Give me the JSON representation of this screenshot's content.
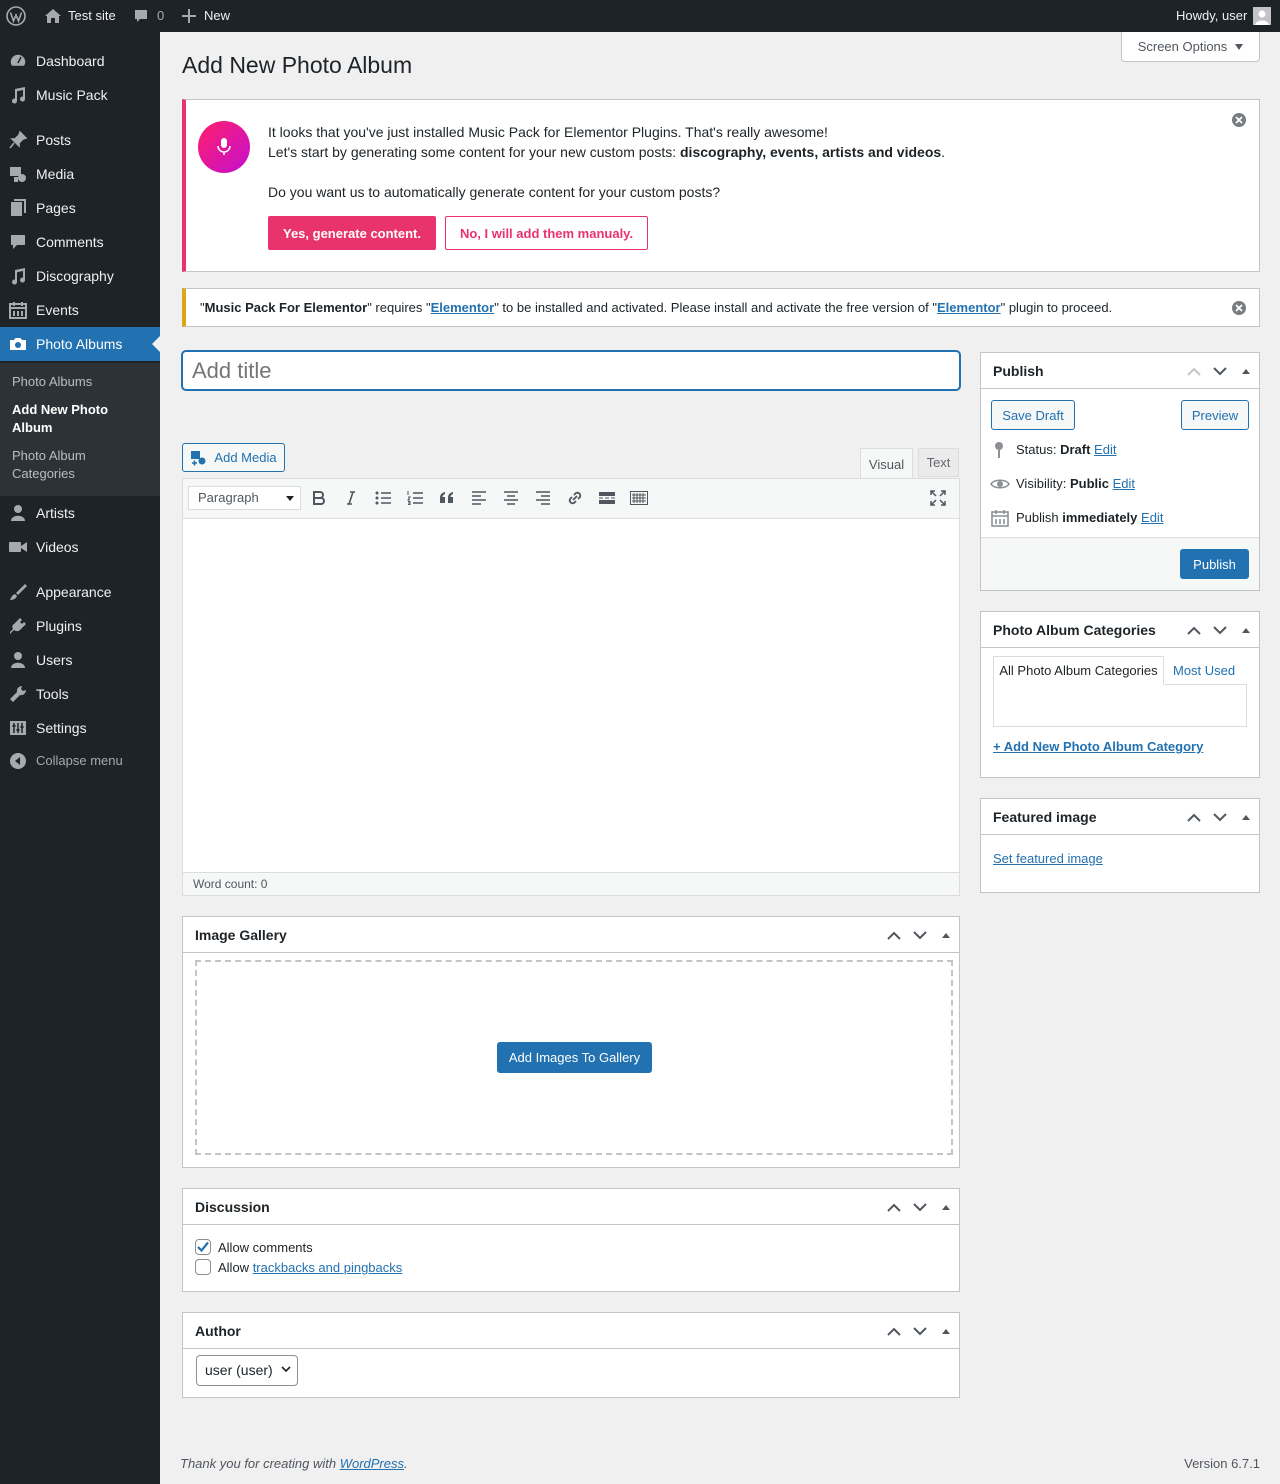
{
  "adminbar": {
    "site_name": "Test site",
    "comments_count": "0",
    "new_label": "New",
    "howdy": "Howdy, user"
  },
  "sidebar": {
    "items": [
      {
        "label": "Dashboard",
        "icon": "dashboard-icon"
      },
      {
        "label": "Music Pack",
        "icon": "music-note-icon"
      },
      {
        "label": "Posts",
        "icon": "pin-icon"
      },
      {
        "label": "Media",
        "icon": "media-icon"
      },
      {
        "label": "Pages",
        "icon": "pages-icon"
      },
      {
        "label": "Comments",
        "icon": "comment-icon"
      },
      {
        "label": "Discography",
        "icon": "music-note-icon"
      },
      {
        "label": "Events",
        "icon": "calendar-icon"
      },
      {
        "label": "Photo Albums",
        "icon": "camera-icon"
      },
      {
        "label": "Artists",
        "icon": "user-icon"
      },
      {
        "label": "Videos",
        "icon": "video-icon"
      },
      {
        "label": "Appearance",
        "icon": "brush-icon"
      },
      {
        "label": "Plugins",
        "icon": "plugin-icon"
      },
      {
        "label": "Users",
        "icon": "users-icon"
      },
      {
        "label": "Tools",
        "icon": "wrench-icon"
      },
      {
        "label": "Settings",
        "icon": "settings-icon"
      }
    ],
    "submenu": [
      "Photo Albums",
      "Add New Photo Album",
      "Photo Album Categories"
    ],
    "collapse": "Collapse menu"
  },
  "page": {
    "title": "Add New Photo Album",
    "screen_options": "Screen Options"
  },
  "notice1": {
    "line1": "It looks that you've just installed Music Pack for Elementor Plugins. That's really awesome!",
    "line2_prefix": "Let's start by generating some content for your new custom posts: ",
    "line2_bold": "discography, events, artists and videos",
    "line2_suffix": ".",
    "question": "Do you want us to automatically generate content for your custom posts?",
    "yes_button": "Yes, generate content.",
    "no_button": "No, I will add them manualy."
  },
  "notice2": {
    "q1": "\"",
    "plugin": "Music Pack For Elementor",
    "t1": "\" requires \"",
    "link1": "Elementor",
    "t2": "\" to be installed and activated. Please install and activate the free version of \"",
    "link2": "Elementor",
    "t3": "\" plugin to proceed."
  },
  "editor": {
    "title_placeholder": "Add title",
    "add_media": "Add Media",
    "tab_visual": "Visual",
    "tab_text": "Text",
    "format_select": "Paragraph",
    "word_count": "Word count: 0"
  },
  "gallery": {
    "title": "Image Gallery",
    "button": "Add Images To Gallery"
  },
  "discussion": {
    "title": "Discussion",
    "allow_comments": "Allow comments",
    "allow_prefix": "Allow ",
    "trackbacks_link": "trackbacks and pingbacks"
  },
  "author": {
    "title": "Author",
    "selected": "user (user)"
  },
  "publish": {
    "title": "Publish",
    "save_draft": "Save Draft",
    "preview": "Preview",
    "status_label": "Status: ",
    "status_value": "Draft",
    "visibility_label": "Visibility: ",
    "visibility_value": "Public",
    "publish_label": "Publish ",
    "publish_value": "immediately",
    "edit": "Edit",
    "publish_button": "Publish"
  },
  "categories": {
    "title": "Photo Album Categories",
    "tab_all": "All Photo Album Categories",
    "tab_most_used": "Most Used",
    "add_new": "+ Add New Photo Album Category"
  },
  "featured": {
    "title": "Featured image",
    "set_link": "Set featured image"
  },
  "footer": {
    "thanks_prefix": "Thank you for creating with ",
    "wp_link": "WordPress",
    "thanks_suffix": ".",
    "version": "Version 6.7.1"
  },
  "colors": {
    "accent": "#2271b1",
    "pink": "#e8336d",
    "warning": "#dba617",
    "admin_dark": "#1d2327"
  }
}
